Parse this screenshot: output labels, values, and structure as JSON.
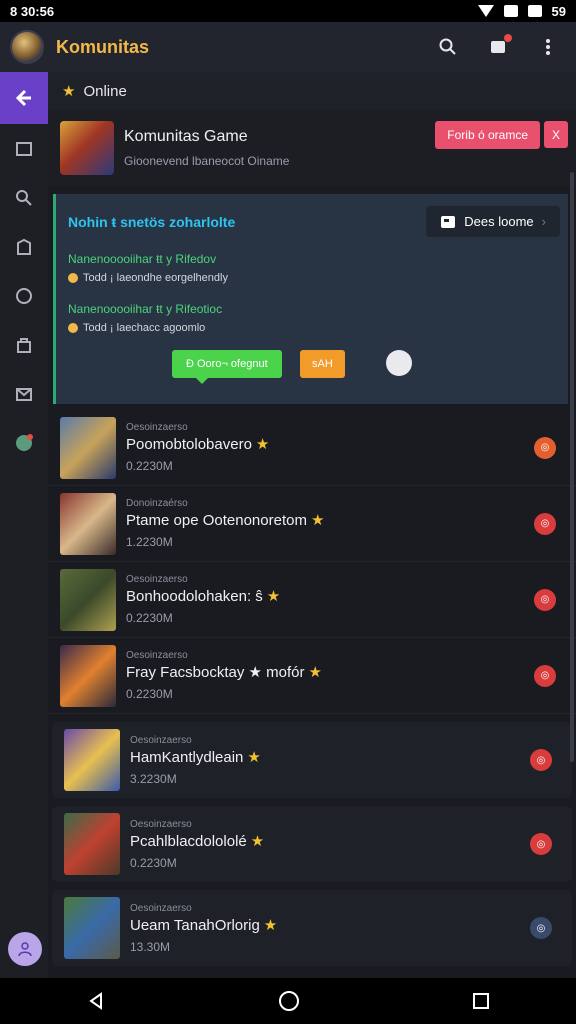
{
  "status": {
    "time": "8 30:56",
    "battery": "59"
  },
  "appbar": {
    "title": "Komunitas"
  },
  "online": {
    "label": "Online"
  },
  "game": {
    "title": "Komunitas Game",
    "subtitle": "Gioonevend lbaneocot Oiname",
    "primary_button": "Forib ó oramce",
    "close_label": "X"
  },
  "promo": {
    "title": "Nohin ŧ snetös zoharlolte",
    "button": "Dees loome",
    "line1": "Nanenooooiihar ŧt y Rifedov",
    "line1_sub": "Todd ¡ laeondhe eorgelhendly",
    "line2": "Nanenooooiihar ŧt y Rifeotioc",
    "line2_sub": "Todd ¡ laechacc agoomlo",
    "chat_button": "Ð Ooro¬ ofegnut",
    "orange_button": "sAH"
  },
  "list": [
    {
      "meta": "Oesoinzaerso",
      "title": "Poomobtolobavero",
      "size": "0.2230M",
      "badge_color": "#e2602d",
      "thumb": [
        "#5a7aa8",
        "#c8a35a",
        "#2c3a6a"
      ]
    },
    {
      "meta": "Donoinzaérso",
      "title": "Ptame ope Ootenonoretom",
      "size": "1.2230M",
      "badge_color": "#d83c3c",
      "thumb": [
        "#8a3530",
        "#d8b88a",
        "#3a2a2a"
      ]
    },
    {
      "meta": "Oesoinzaerso",
      "title": "Bonhoodolohaken: ŝ",
      "size": "0.2230M",
      "badge_color": "#d83c3c",
      "thumb": [
        "#5a6a3a",
        "#3a4a2a",
        "#b0a050"
      ]
    },
    {
      "meta": "Oesoinzaerso",
      "title": "Fray Facsbocktay ★ mofór",
      "size": "0.2230M",
      "badge_color": "#d83c3c",
      "thumb": [
        "#3a2a4a",
        "#e08030",
        "#2a2a3a"
      ]
    },
    {
      "meta": "Oesoinzaerso",
      "title": "HamKantlydleain",
      "size": "3.2230M",
      "badge_color": "#d83c3c",
      "thumb": [
        "#6a4aa8",
        "#e8c050",
        "#3a5aa8"
      ]
    },
    {
      "meta": "Oesoinzaerso",
      "title": "Pcahlblacdolololé",
      "size": "0.2230M",
      "badge_color": "#d83c3c",
      "thumb": [
        "#3a6a4a",
        "#c04030",
        "#4a3a2a"
      ]
    },
    {
      "meta": "Oesoinzaerso",
      "title": "Ueam TanahOrlorig",
      "size": "13.30M",
      "badge_color": "#3a4a6a",
      "thumb": [
        "#4a7a3a",
        "#3a6aa8",
        "#5a5a4a"
      ]
    }
  ]
}
